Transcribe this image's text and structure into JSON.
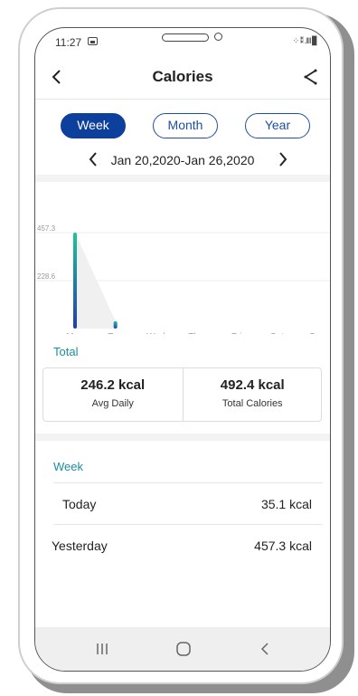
{
  "status_bar": {
    "time": "11:27",
    "signal_text": "⁘ ⁑ .‖‖ ▊"
  },
  "header": {
    "title": "Calories"
  },
  "segments": [
    {
      "label": "Week",
      "active": true
    },
    {
      "label": "Month",
      "active": false
    },
    {
      "label": "Year",
      "active": false
    }
  ],
  "date_range": "Jan 20,2020-Jan 26,2020",
  "chart_data": {
    "type": "bar",
    "categories": [
      "Mon",
      "Tue",
      "Wed",
      "Thu",
      "Fri",
      "Sat",
      "Sun"
    ],
    "values": [
      457.3,
      35.1,
      0,
      0,
      0,
      0,
      0
    ],
    "ytick_labels": [
      "457.3",
      "228.6"
    ],
    "ylim": [
      0,
      457.3
    ],
    "colors": {
      "bar_top": "#1fc49a",
      "bar_bottom": "#1f3fb0",
      "grid": "#eeeeee",
      "area": "#f0f0f0"
    }
  },
  "total": {
    "label": "Total",
    "avg_daily_value": "246.2 kcal",
    "avg_daily_label": "Avg Daily",
    "total_value": "492.4 kcal",
    "total_label": "Total Calories"
  },
  "week": {
    "label": "Week",
    "rows": [
      {
        "day": "Today",
        "value": "35.1 kcal"
      },
      {
        "day": "Yesterday",
        "value": "457.3 kcal"
      }
    ]
  },
  "colors": {
    "accent": "#0d3f9c",
    "teal": "#1a8ea0"
  },
  "icons": {
    "back": "chevron-left-icon",
    "share": "share-icon",
    "recent": "recent-apps-icon",
    "home": "home-icon",
    "nav_back": "nav-back-icon"
  }
}
